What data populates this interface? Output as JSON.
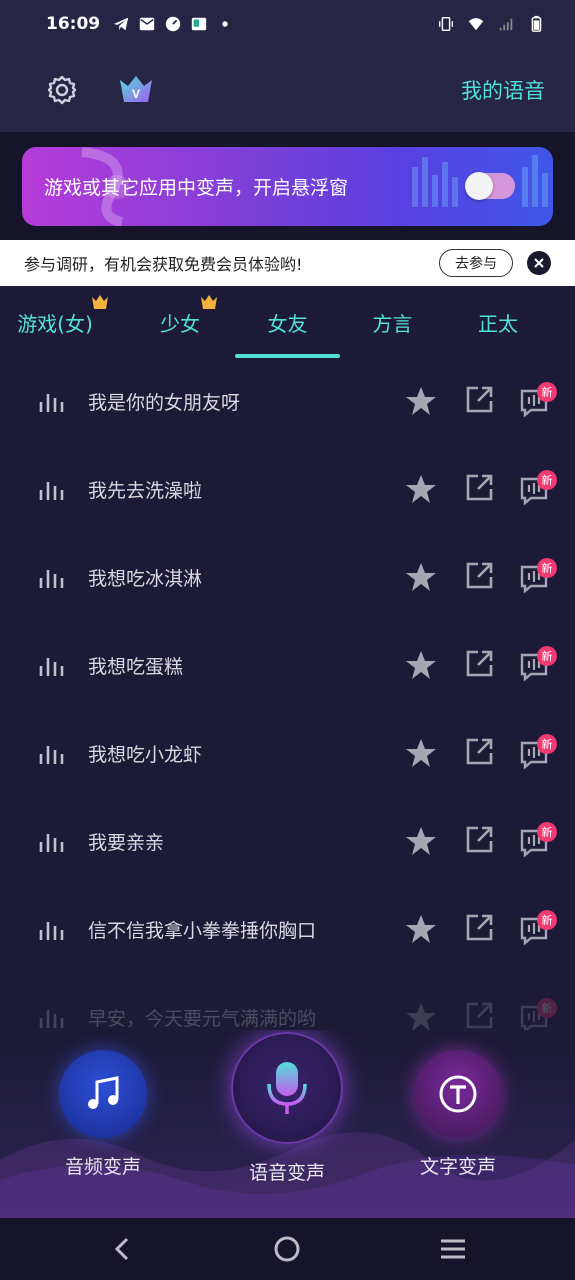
{
  "status": {
    "time": "16:09"
  },
  "header": {
    "my_voice": "我的语音"
  },
  "banner": {
    "text": "游戏或其它应用中变声，开启悬浮窗"
  },
  "survey": {
    "text": "参与调研，有机会获取免费会员体验哟!",
    "button": "去参与"
  },
  "tabs": [
    {
      "label": "游戏(女)",
      "vip": true
    },
    {
      "label": "少女",
      "vip": true
    },
    {
      "label": "女友",
      "vip": false,
      "active": true
    },
    {
      "label": "方言",
      "vip": false
    },
    {
      "label": "正太",
      "vip": false
    }
  ],
  "items": [
    {
      "label": "我是你的女朋友呀",
      "badge": "新"
    },
    {
      "label": "我先去洗澡啦",
      "badge": "新"
    },
    {
      "label": "我想吃冰淇淋",
      "badge": "新"
    },
    {
      "label": "我想吃蛋糕",
      "badge": "新"
    },
    {
      "label": "我想吃小龙虾",
      "badge": "新"
    },
    {
      "label": "我要亲亲",
      "badge": "新"
    },
    {
      "label": "信不信我拿小拳拳捶你胸口",
      "badge": "新"
    },
    {
      "label": "早安，今天要元气满满的哟",
      "badge": "新"
    }
  ],
  "bottom": {
    "audio": "音频变声",
    "voice": "语音变声",
    "text": "文字变声"
  },
  "colors": {
    "accent": "#4fe0d6",
    "badge": "#f23a72",
    "background": "#1c1a36"
  }
}
